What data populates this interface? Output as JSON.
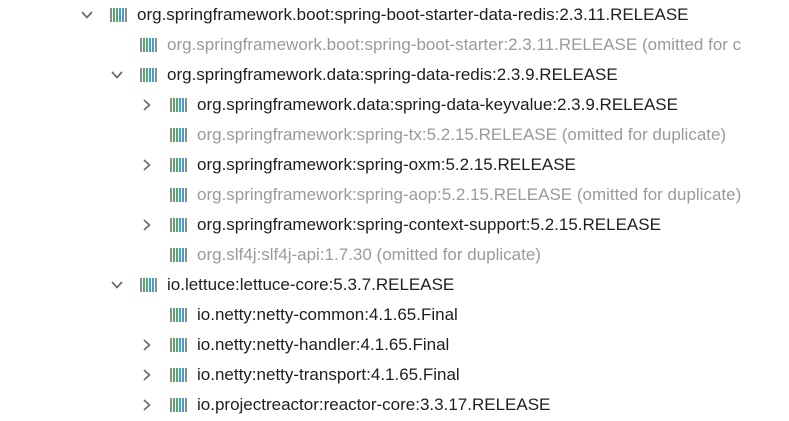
{
  "tree": {
    "rows": [
      {
        "label": "org.springframework.boot:spring-boot-starter-data-redis:2.3.11.RELEASE",
        "state": "expanded",
        "level": 0,
        "omitted": false,
        "icon": "maven-library-icon"
      },
      {
        "label": "org.springframework.boot:spring-boot-starter:2.3.11.RELEASE (omitted for c",
        "state": "leaf",
        "level": 1,
        "omitted": true,
        "icon": "maven-library-icon"
      },
      {
        "label": "org.springframework.data:spring-data-redis:2.3.9.RELEASE",
        "state": "expanded",
        "level": 1,
        "omitted": false,
        "icon": "maven-library-icon"
      },
      {
        "label": "org.springframework.data:spring-data-keyvalue:2.3.9.RELEASE",
        "state": "collapsed",
        "level": 2,
        "omitted": false,
        "icon": "maven-library-icon"
      },
      {
        "label": "org.springframework:spring-tx:5.2.15.RELEASE (omitted for duplicate)",
        "state": "leaf",
        "level": 2,
        "omitted": true,
        "icon": "maven-library-icon"
      },
      {
        "label": "org.springframework:spring-oxm:5.2.15.RELEASE",
        "state": "collapsed",
        "level": 2,
        "omitted": false,
        "icon": "maven-library-icon"
      },
      {
        "label": "org.springframework:spring-aop:5.2.15.RELEASE (omitted for duplicate)",
        "state": "leaf",
        "level": 2,
        "omitted": true,
        "icon": "maven-library-icon"
      },
      {
        "label": "org.springframework:spring-context-support:5.2.15.RELEASE",
        "state": "collapsed",
        "level": 2,
        "omitted": false,
        "icon": "maven-library-icon"
      },
      {
        "label": "org.slf4j:slf4j-api:1.7.30 (omitted for duplicate)",
        "state": "leaf",
        "level": 2,
        "omitted": true,
        "icon": "maven-library-icon"
      },
      {
        "label": "io.lettuce:lettuce-core:5.3.7.RELEASE",
        "state": "expanded",
        "level": 1,
        "omitted": false,
        "icon": "maven-library-icon"
      },
      {
        "label": "io.netty:netty-common:4.1.65.Final",
        "state": "leaf",
        "level": 2,
        "omitted": false,
        "icon": "maven-library-icon"
      },
      {
        "label": "io.netty:netty-handler:4.1.65.Final",
        "state": "collapsed",
        "level": 2,
        "omitted": false,
        "icon": "maven-library-icon"
      },
      {
        "label": "io.netty:netty-transport:4.1.65.Final",
        "state": "collapsed",
        "level": 2,
        "omitted": false,
        "icon": "maven-library-icon"
      },
      {
        "label": "io.projectreactor:reactor-core:3.3.17.RELEASE",
        "state": "collapsed",
        "level": 2,
        "omitted": false,
        "icon": "maven-library-icon"
      }
    ]
  },
  "colors": {
    "text": "#1e1e1e",
    "omitted_text": "#9a9a9a",
    "icon_green": "#59a869",
    "icon_blue": "#40a0d0",
    "icon_gray": "#8c8c8c",
    "arrow": "#6e6e6e"
  }
}
